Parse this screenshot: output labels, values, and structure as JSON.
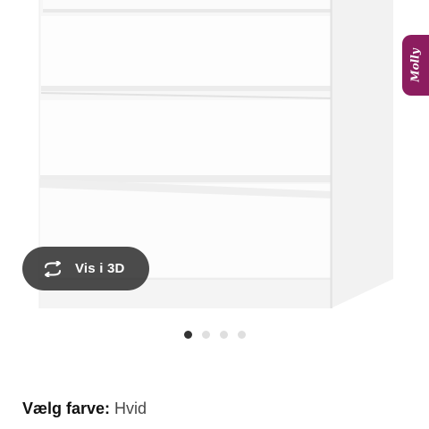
{
  "product_image": {
    "alt": "MALM kommode med 4 skuffer, hvid"
  },
  "view_3d": {
    "label": "Vis i 3D",
    "icon": "rotate-3d-icon"
  },
  "chat_widget": {
    "label": "Molly",
    "color": "#8c1d5f"
  },
  "carousel": {
    "count": 4,
    "active_index": 0
  },
  "color_selector": {
    "label": "Vælg farve:",
    "value": "Hvid"
  },
  "colors": {
    "button_bg": "#282828",
    "dot_active": "#333333",
    "dot_inactive": "#dfdfdf"
  }
}
